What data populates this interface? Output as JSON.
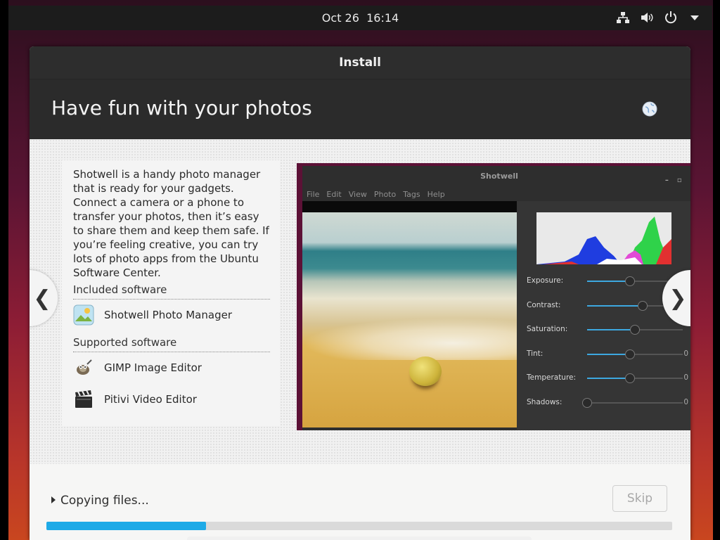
{
  "topbar": {
    "date": "Oct 26",
    "time": "16:14",
    "icons": [
      "network-icon",
      "volume-icon",
      "power-icon",
      "chevron-down-icon"
    ]
  },
  "window": {
    "title": "Install",
    "heading": "Have fun with your photos"
  },
  "slide": {
    "description": "Shotwell is a handy photo manager that is ready for your gadgets. Connect a camera or a phone to transfer your photos, then it’s easy to share them and keep them safe. If you’re feeling creative, you can try lots of photo apps from the Ubuntu Software Center.",
    "included_label": "Included software",
    "included": [
      {
        "name": "Shotwell Photo Manager",
        "icon": "shotwell-icon"
      }
    ],
    "supported_label": "Supported software",
    "supported": [
      {
        "name": "GIMP Image Editor",
        "icon": "gimp-icon"
      },
      {
        "name": "Pitivi Video Editor",
        "icon": "pitivi-icon"
      }
    ],
    "prev_glyph": "❮",
    "next_glyph": "❯"
  },
  "screenshot": {
    "app_title": "Shotwell",
    "menu": [
      "File",
      "Edit",
      "View",
      "Photo",
      "Tags",
      "Help"
    ],
    "adjustments": [
      {
        "label": "Exposure:",
        "level": 0.45,
        "value": ""
      },
      {
        "label": "Contrast:",
        "level": 0.58,
        "value": ""
      },
      {
        "label": "Saturation:",
        "level": 0.5,
        "value": ""
      },
      {
        "label": "Tint:",
        "level": 0.45,
        "value": "0"
      },
      {
        "label": "Temperature:",
        "level": 0.45,
        "value": "0"
      },
      {
        "label": "Shadows:",
        "level": 0.0,
        "value": "0"
      }
    ]
  },
  "footer": {
    "status": "Copying files...",
    "skip_label": "Skip",
    "progress": 0.255
  },
  "colors": {
    "accent": "#1eaae7",
    "header_bg": "#2b2b2b",
    "topbar_bg": "#1c1c1c"
  }
}
